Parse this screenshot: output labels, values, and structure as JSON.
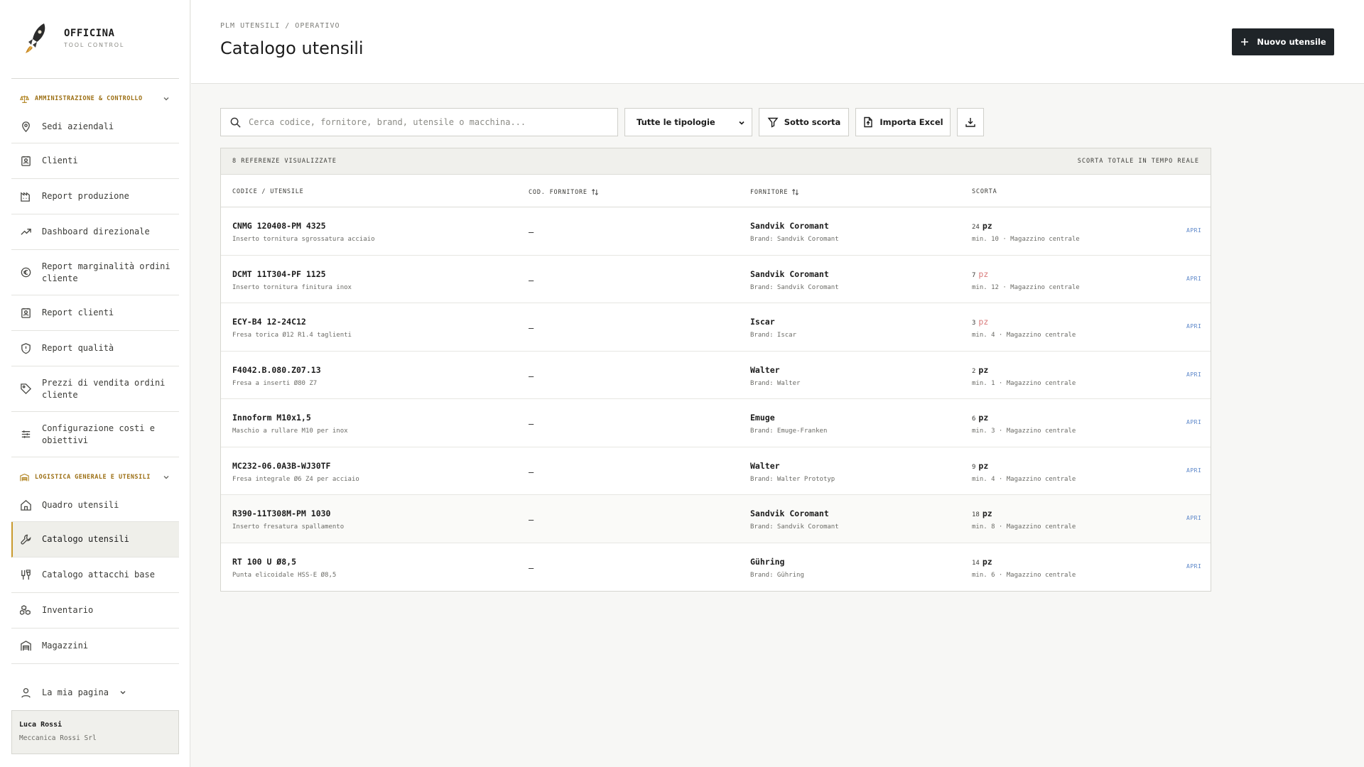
{
  "brand": {
    "name": "OFFICINA",
    "subtitle": "TOOL CONTROL"
  },
  "sidebar": {
    "section_admin": "AMMINISTRAZIONE & CONTROLLO",
    "section_logistics": "LOGISTICA GENERALE E UTENSILI",
    "admin_items": [
      {
        "label": "Sedi aziendali",
        "icon": "map-pin-icon"
      },
      {
        "label": "Clienti",
        "icon": "contact-icon"
      },
      {
        "label": "Report produzione",
        "icon": "factory-icon"
      },
      {
        "label": "Dashboard direzionale",
        "icon": "trending-up-icon"
      },
      {
        "label": "Report marginalità ordini cliente",
        "icon": "euro-icon"
      },
      {
        "label": "Report clienti",
        "icon": "contact-icon"
      },
      {
        "label": "Report qualità",
        "icon": "shield-icon"
      },
      {
        "label": "Prezzi di vendita ordini cliente",
        "icon": "tag-icon"
      },
      {
        "label": "Configurazione costi e obiettivi",
        "icon": "sliders-icon"
      }
    ],
    "logistics_items": [
      {
        "label": "Quadro utensili",
        "icon": "home-icon"
      },
      {
        "label": "Catalogo utensili",
        "icon": "wrench-icon",
        "active": true
      },
      {
        "label": "Catalogo attacchi base",
        "icon": "tool-holder-icon"
      },
      {
        "label": "Inventario",
        "icon": "boxes-icon"
      },
      {
        "label": "Magazzini",
        "icon": "warehouse-icon"
      }
    ],
    "user_menu": "La mia pagina",
    "user": {
      "name": "Luca Rossi",
      "company": "Meccanica Rossi Srl"
    }
  },
  "header": {
    "breadcrumb": "PLM UTENSILI / OPERATIVO",
    "title": "Catalogo utensili",
    "new_button": "Nuovo utensile"
  },
  "toolbar": {
    "search_placeholder": "Cerca codice, fornitore, brand, utensile o macchina...",
    "type_select": "Tutte le tipologie",
    "understock": "Sotto scorta",
    "import": "Importa Excel"
  },
  "table": {
    "count_label": "8 REFERENZE VISUALIZZATE",
    "realtime_label": "SCORTA TOTALE IN TEMPO REALE",
    "headers": {
      "code": "CODICE / UTENSILE",
      "supplier_code": "COD. FORNITORE",
      "supplier": "FORNITORE",
      "stock": "SCORTA"
    },
    "open_label": "APRI",
    "rows": [
      {
        "code": "CNMG 120408-PM 4325",
        "desc": "Inserto tornitura sgrossatura acciaio",
        "supplier_code": "—",
        "supplier": "Sandvik Coromant",
        "brand": "Brand: Sandvik Coromant",
        "qty": "24",
        "unit": "pz",
        "low": false,
        "min": "min. 10 · Magazzino centrale"
      },
      {
        "code": "DCMT 11T304-PF 1125",
        "desc": "Inserto tornitura finitura inox",
        "supplier_code": "—",
        "supplier": "Sandvik Coromant",
        "brand": "Brand: Sandvik Coromant",
        "qty": "7",
        "unit": "pz",
        "low": true,
        "min": "min. 12 · Magazzino centrale"
      },
      {
        "code": "ECY-B4 12-24C12",
        "desc": "Fresa torica Ø12 R1.4 taglienti",
        "supplier_code": "—",
        "supplier": "Iscar",
        "brand": "Brand: Iscar",
        "qty": "3",
        "unit": "pz",
        "low": true,
        "min": "min. 4 · Magazzino centrale"
      },
      {
        "code": "F4042.B.080.Z07.13",
        "desc": "Fresa a inserti Ø80 Z7",
        "supplier_code": "—",
        "supplier": "Walter",
        "brand": "Brand: Walter",
        "qty": "2",
        "unit": "pz",
        "low": false,
        "min": "min. 1 · Magazzino centrale"
      },
      {
        "code": "Innoform M10x1,5",
        "desc": "Maschio a rullare M10 per inox",
        "supplier_code": "—",
        "supplier": "Emuge",
        "brand": "Brand: Emuge-Franken",
        "qty": "6",
        "unit": "pz",
        "low": false,
        "min": "min. 3 · Magazzino centrale"
      },
      {
        "code": "MC232-06.0A3B-WJ30TF",
        "desc": "Fresa integrale Ø6 Z4 per acciaio",
        "supplier_code": "—",
        "supplier": "Walter",
        "brand": "Brand: Walter Prototyp",
        "qty": "9",
        "unit": "pz",
        "low": false,
        "min": "min. 4 · Magazzino centrale"
      },
      {
        "code": "R390-11T308M-PM 1030",
        "desc": "Inserto fresatura spallamento",
        "supplier_code": "—",
        "supplier": "Sandvik Coromant",
        "brand": "Brand: Sandvik Coromant",
        "qty": "18",
        "unit": "pz",
        "low": false,
        "min": "min. 8 · Magazzino centrale"
      },
      {
        "code": "RT 100 U Ø8,5",
        "desc": "Punta elicoidale HSS-E Ø8,5",
        "supplier_code": "—",
        "supplier": "Gühring",
        "brand": "Brand: Gühring",
        "qty": "14",
        "unit": "pz",
        "low": false,
        "min": "min. 6 · Magazzino centrale"
      }
    ]
  },
  "colors": {
    "accent": "#c99a2e",
    "primary_button": "#1f2428",
    "low_stock": "#d97a7a",
    "link": "#5b86c9"
  }
}
